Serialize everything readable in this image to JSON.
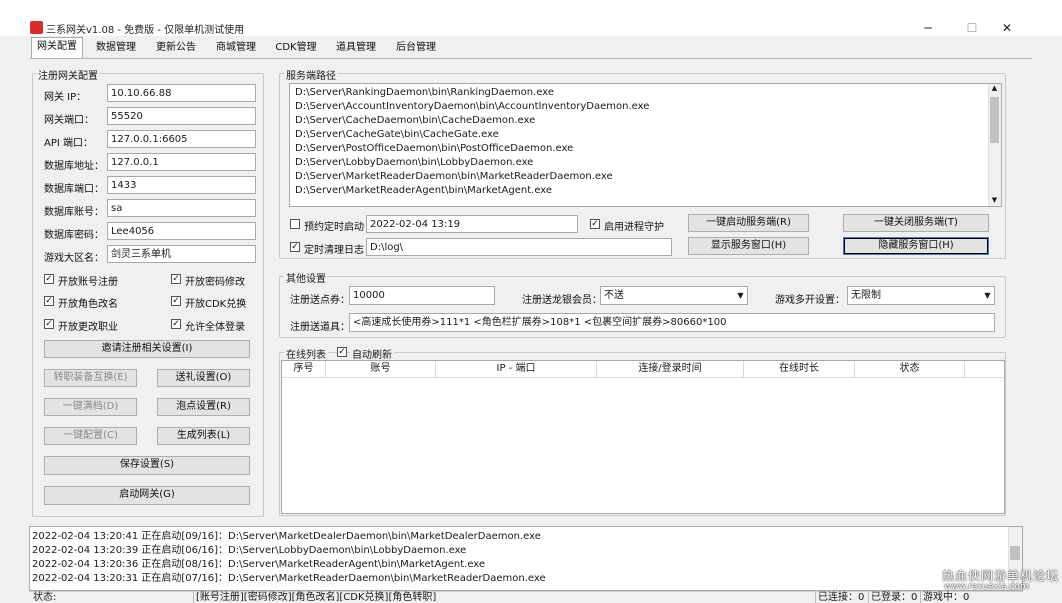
{
  "window": {
    "title": "三系网关v1.08 - 免费版 - 仅限单机测试使用",
    "minimize": "─",
    "maximize": "☐",
    "close": "✕"
  },
  "tabs": [
    "网关配置",
    "数据管理",
    "更新公告",
    "商城管理",
    "CDK管理",
    "道具管理",
    "后台管理"
  ],
  "register": {
    "group_title": "注册网关配置",
    "fields": [
      {
        "label": "网关 IP：",
        "value": "10.10.66.88"
      },
      {
        "label": "网关端口：",
        "value": "55520"
      },
      {
        "label": "API 端口：",
        "value": "127.0.0.1:6605"
      },
      {
        "label": "数据库地址：",
        "value": "127.0.0.1"
      },
      {
        "label": "数据库端口：",
        "value": "1433"
      },
      {
        "label": "数据库账号：",
        "value": "sa"
      },
      {
        "label": "数据库密码：",
        "value": "Lee4056"
      },
      {
        "label": "游戏大区名：",
        "value": "剑灵三系单机"
      }
    ],
    "checkboxes": [
      {
        "label": "开放账号注册",
        "checked": true
      },
      {
        "label": "开放密码修改",
        "checked": true
      },
      {
        "label": "开放角色改名",
        "checked": true
      },
      {
        "label": "开放CDK兑换",
        "checked": true
      },
      {
        "label": "开放更改职业",
        "checked": true
      },
      {
        "label": "允许全体登录",
        "checked": true
      }
    ],
    "check_mark": "✓",
    "invite_btn": "邀请注册相关设置(I)",
    "btn_transfer": "转职装备互换(E)",
    "btn_gift": "送礼设置(O)",
    "btn_onekey_full": "一键满档(D)",
    "btn_points": "泡点设置(R)",
    "btn_onekey_config": "一键配置(C)",
    "btn_gen_list": "生成列表(L)",
    "btn_save": "保存设置(S)",
    "btn_start": "启动网关(G)"
  },
  "service": {
    "group_title": "服务端路径",
    "paths": [
      "D:\\Server\\RankingDaemon\\bin\\RankingDaemon.exe",
      "D:\\Server\\AccountInventoryDaemon\\bin\\AccountInventoryDaemon.exe",
      "D:\\Server\\CacheDaemon\\bin\\CacheDaemon.exe",
      "D:\\Server\\CacheGate\\bin\\CacheGate.exe",
      "D:\\Server\\PostOfficeDaemon\\bin\\PostOfficeDaemon.exe",
      "D:\\Server\\LobbyDaemon\\bin\\LobbyDaemon.exe",
      "D:\\Server\\MarketReaderDaemon\\bin\\MarketReaderDaemon.exe",
      "D:\\Server\\MarketReaderAgent\\bin\\MarketAgent.exe"
    ],
    "scheduled_start_label": "预约定时启动",
    "scheduled_start_checked": false,
    "scheduled_start_value": "2022-02-04 13:19",
    "guard_label": "启用进程守护",
    "guard_checked": true,
    "btn_onekey_start": "一键启动服务端(R)",
    "btn_onekey_stop": "一键关闭服务端(T)",
    "clear_log_label": "定时清理日志",
    "clear_log_checked": true,
    "clear_log_value": "D:\\log\\",
    "btn_show_window": "显示服务窗口(H)",
    "btn_hide_window": "隐藏服务窗口(H)"
  },
  "other": {
    "group_title": "其他设置",
    "reg_points_label": "注册送点券：",
    "reg_points_value": "10000",
    "reg_vip_label": "注册送龙银会员：",
    "reg_vip_value": "不送",
    "multi_open_label": "游戏多开设置：",
    "multi_open_value": "无限制",
    "reg_items_label": "注册送道具：",
    "reg_items_value": "<高速成长使用券>111*1 <角色栏扩展券>108*1 <包裹空间扩展券>80660*100",
    "dropdown_icon": "▼"
  },
  "online": {
    "group_title": "在线列表",
    "auto_refresh_label": "自动刷新",
    "auto_refresh_checked": true,
    "columns": [
      "序号",
      "账号",
      "IP - 端口",
      "连接/登录时间",
      "在线时长",
      "状态"
    ]
  },
  "log": {
    "lines": [
      "2022-02-04 13:20:41  正在启动[09/16]：D:\\Server\\MarketDealerDaemon\\bin\\MarketDealerDaemon.exe",
      "2022-02-04 13:20:39  正在启动[06/16]：D:\\Server\\LobbyDaemon\\bin\\LobbyDaemon.exe",
      "2022-02-04 13:20:36  正在启动[08/16]：D:\\Server\\MarketReaderAgent\\bin\\MarketAgent.exe",
      "2022-02-04 13:20:31  正在启动[07/16]：D:\\Server\\MarketReaderDaemon\\bin\\MarketReaderDaemon.exe"
    ]
  },
  "statusbar": {
    "status_label": "状态:",
    "features": "[账号注册][密码修改][角色改名][CDK兑换][角色转职]",
    "connected": "已连接：0",
    "logged_in": "已登录：0",
    "in_game": "游戏中：0"
  },
  "watermark": {
    "line1": "热血侠网游单机论坛",
    "line2": "www.rexuexia.com"
  }
}
